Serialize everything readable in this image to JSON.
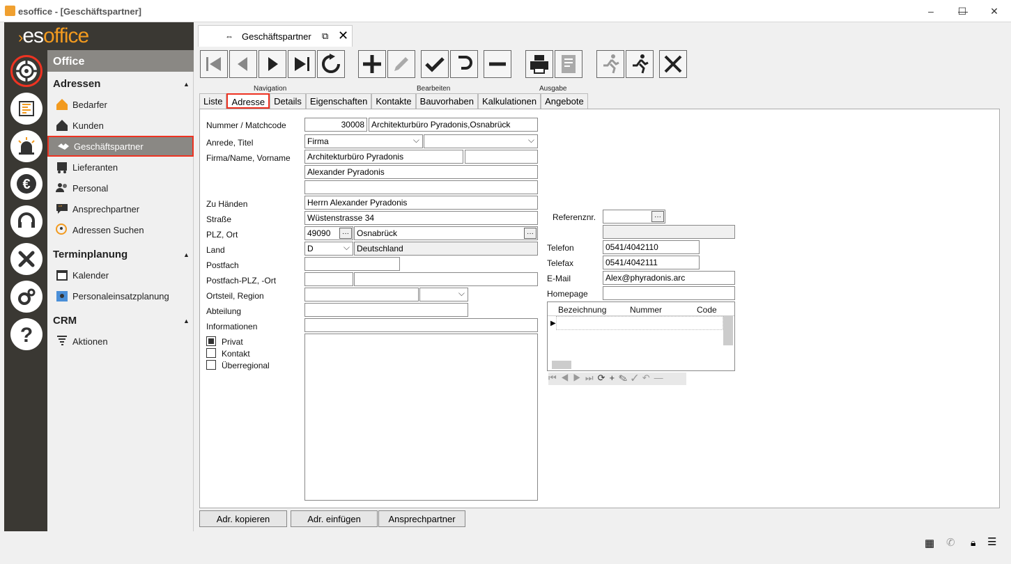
{
  "window": {
    "title": "esoffice - [Geschäftspartner]"
  },
  "logo": {
    "prefix": "es",
    "suffix": "office"
  },
  "sidebar": {
    "header": "Office",
    "sections": [
      {
        "title": "Adressen",
        "items": [
          "Bedarfer",
          "Kunden",
          "Geschäftspartner",
          "Lieferanten",
          "Personal",
          "Ansprechpartner",
          "Adressen Suchen"
        ]
      },
      {
        "title": "Terminplanung",
        "items": [
          "Kalender",
          "Personaleinsatzplanung"
        ]
      },
      {
        "title": "CRM",
        "items": [
          "Aktionen"
        ]
      }
    ],
    "selected": "Geschäftspartner"
  },
  "doc_tab": {
    "label": "Geschäftspartner"
  },
  "toolbar": {
    "groups": [
      "Navigation",
      "Bearbeiten",
      "Ausgabe"
    ]
  },
  "tabs": [
    "Liste",
    "Adresse",
    "Details",
    "Eigenschaften",
    "Kontakte",
    "Bauvorhaben",
    "Kalkulationen",
    "Angebote"
  ],
  "selected_tab": "Adresse",
  "form": {
    "labels": {
      "nummer": "Nummer / Matchcode",
      "anrede": "Anrede, Titel",
      "firma": "Firma/Name, Vorname",
      "zuhaenden": "Zu Händen",
      "strasse": "Straße",
      "plzort": "PLZ, Ort",
      "land": "Land",
      "postfach": "Postfach",
      "postfachplz": "Postfach-PLZ, -Ort",
      "ortsteil": "Ortsteil, Region",
      "abteilung": "Abteilung",
      "informationen": "Informationen",
      "referenz": "Referenznr.",
      "telefon": "Telefon",
      "telefax": "Telefax",
      "email": "E-Mail",
      "homepage": "Homepage"
    },
    "values": {
      "nummer": "30008",
      "matchcode": "Architekturbüro Pyradonis,Osnabrück",
      "anrede": "Firma",
      "firma": "Architekturbüro Pyradonis",
      "name2": "Alexander Pyradonis",
      "zuhaenden": "Herrn Alexander Pyradonis",
      "strasse": "Wüstenstrasse 34",
      "plz": "49090",
      "ort": "Osnabrück",
      "land_code": "D",
      "land": "Deutschland",
      "telefon": "0541/4042110",
      "telefax": "0541/4042111",
      "email": "Alex@phyradonis.arc"
    },
    "checkboxes": [
      {
        "label": "Privat",
        "checked": true
      },
      {
        "label": "Kontakt",
        "checked": false
      },
      {
        "label": "Überregional",
        "checked": false
      }
    ],
    "grid_columns": [
      "Bezeichnung",
      "Nummer",
      "Code"
    ]
  },
  "buttons": [
    "Adr. kopieren",
    "Adr. einfügen",
    "Ansprechpartner"
  ]
}
